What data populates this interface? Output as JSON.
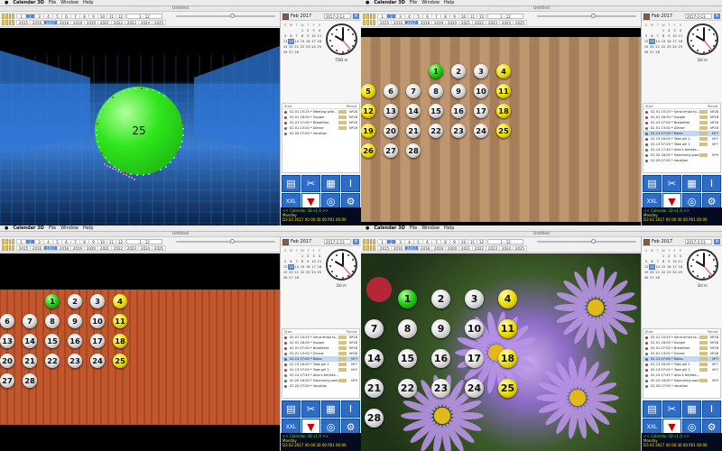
{
  "app_menu": {
    "app": "Calendar 3D",
    "items": [
      "File",
      "Window",
      "Help"
    ]
  },
  "window_title": "Untitled",
  "months": [
    "1",
    "2",
    "3",
    "4",
    "5",
    "6",
    "7",
    "8",
    "9",
    "10",
    "11",
    "12"
  ],
  "selected_month": "2",
  "month_range": "1 - 12",
  "years": [
    "2015",
    "2016",
    "2017",
    "2018",
    "2019",
    "2020",
    "2021",
    "2022",
    "2023",
    "2024",
    "2025"
  ],
  "selected_year": "2017",
  "sidebar": {
    "month_label": "Feb 2017",
    "date_field": "2017-2-13",
    "m_button": "M",
    "weekday_headers": [
      "S",
      "M",
      "T",
      "W",
      "T",
      "F",
      "S"
    ],
    "calendar_days": [
      "",
      "",
      "",
      "1",
      "2",
      "3",
      "4",
      "5",
      "6",
      "7",
      "8",
      "9",
      "10",
      "11",
      "12",
      "13",
      "14",
      "15",
      "16",
      "17",
      "18",
      "19",
      "20",
      "21",
      "22",
      "23",
      "24",
      "25",
      "26",
      "27",
      "28",
      "",
      "",
      "",
      ""
    ],
    "today": "13",
    "clock_labels": [
      "TDD m",
      "Dd m",
      "Dd m",
      "Dd m"
    ]
  },
  "events_panel": {
    "head_start": "Start",
    "head_period": "Period",
    "views": [
      [
        {
          "text": "02.01 15:25 * Meeting with...",
          "period": "N*28",
          "color": "#d22"
        },
        {
          "text": "02.01 18:00 * Supper",
          "period": "N*28",
          "color": "#d22"
        },
        {
          "text": "02.01 07:00 * Breakfast",
          "period": "N*28",
          "color": "#d22"
        },
        {
          "text": "02.01 13:00 * Dinner",
          "period": "N*28",
          "color": "#1a1"
        },
        {
          "text": "02.20 07:00 * Vacation",
          "period": "",
          "color": "#2a6ad8"
        }
      ],
      [
        {
          "text": "02.01 15:25 * Send email to...",
          "period": "N*28",
          "color": "#d22"
        },
        {
          "text": "02.01 18:00 * Supper",
          "period": "N*28",
          "color": "#d22"
        },
        {
          "text": "02.01 07:00 * Breakfast",
          "period": "N*28",
          "color": "#d22"
        },
        {
          "text": "02.01 13:00 * Dinner",
          "period": "N*28",
          "color": "#1a1"
        },
        {
          "text": "02.13 07:00 * Relax",
          "period": "N*7",
          "color": "#2a6ad8"
        },
        {
          "text": "02.13 16:00 * Take pill 2",
          "period": "N*7",
          "color": "#d22"
        },
        {
          "text": "02.13 07:00 * Take pill 1",
          "period": "N*7",
          "color": "#d22"
        },
        {
          "text": "02.14 17:45 * Alex's birthda...",
          "period": "",
          "color": "#1a1"
        },
        {
          "text": "02.20 16:00 * Swimming pool",
          "period": "N*5",
          "color": "#2a6ad8"
        },
        {
          "text": "02.20 07:00 * Vacation",
          "period": "",
          "color": "#2a6ad8"
        }
      ],
      [
        {
          "text": "02.01 15:25 * Send email to...",
          "period": "N*28",
          "color": "#d22"
        },
        {
          "text": "02.01 18:00 * Supper",
          "period": "N*28",
          "color": "#d22"
        },
        {
          "text": "02.01 07:00 * Breakfast",
          "period": "N*28",
          "color": "#d22"
        },
        {
          "text": "02.01 13:00 * Dinner",
          "period": "N*28",
          "color": "#1a1"
        },
        {
          "text": "02.13 07:00 * Relax",
          "period": "N*7",
          "color": "#2a6ad8"
        },
        {
          "text": "02.13 16:00 * Take pill 2",
          "period": "N*7",
          "color": "#d22"
        },
        {
          "text": "02.13 07:00 * Take pill 1",
          "period": "N*7",
          "color": "#d22"
        },
        {
          "text": "02.14 17:45 * Alex's birthda...",
          "period": "",
          "color": "#1a1"
        },
        {
          "text": "02.20 16:00 * Swimming pool",
          "period": "N*5",
          "color": "#2a6ad8"
        },
        {
          "text": "02.20 07:00 * Vacation",
          "period": "",
          "color": "#2a6ad8"
        }
      ],
      [
        {
          "text": "02.01 15:25 * Send email to...",
          "period": "N*28",
          "color": "#d22"
        },
        {
          "text": "02.01 18:00 * Supper",
          "period": "N*28",
          "color": "#d22"
        },
        {
          "text": "02.01 07:00 * Breakfast",
          "period": "N*28",
          "color": "#d22"
        },
        {
          "text": "02.01 13:00 * Dinner",
          "period": "N*28",
          "color": "#1a1"
        },
        {
          "text": "02.13 07:00 * Relax",
          "period": "N*7",
          "color": "#2a6ad8"
        },
        {
          "text": "02.13 16:00 * Take pill 2",
          "period": "N*7",
          "color": "#d22"
        },
        {
          "text": "02.13 07:00 * Take pill 1",
          "period": "N*7",
          "color": "#d22"
        },
        {
          "text": "02.14 17:45 * Alex's birthda...",
          "period": "",
          "color": "#1a1"
        },
        {
          "text": "02.20 16:00 * Swimming pool",
          "period": "N*5",
          "color": "#2a6ad8"
        },
        {
          "text": "02.20 07:00 * Vacation",
          "period": "",
          "color": "#2a6ad8"
        }
      ]
    ]
  },
  "toolbar_icons": [
    {
      "name": "chart-icon",
      "glyph": "▤"
    },
    {
      "name": "tools-icon",
      "glyph": "✂"
    },
    {
      "name": "grid-icon",
      "glyph": "▦"
    },
    {
      "name": "pillar-icon",
      "glyph": "Ⅰ"
    },
    {
      "name": "xxl-icon",
      "glyph": "XXL"
    },
    {
      "name": "clothing-icon",
      "glyph": "▼"
    },
    {
      "name": "life-ring-icon",
      "glyph": "◎"
    },
    {
      "name": "gear-icon",
      "glyph": "⚙"
    }
  ],
  "info_panel": {
    "version": "<< Calendar 3D v1.0 >>",
    "weekday": "Monday",
    "day_number": "13",
    "numbers_line": "D3 02 2017 00 00:30 00 P01 00:00",
    "extra": "Ljh Driving trainin"
  },
  "view_backgrounds": [
    "grid-landscape",
    "wood-floor",
    "red-wall",
    "flower-photo"
  ],
  "big_sphere_label": "25",
  "colors": {
    "accent": "#4f86d6",
    "infopanel_text": "#5ee05a",
    "infopanel_yellow": "#ffe000",
    "infopanel_red": "#ff3a3a"
  }
}
